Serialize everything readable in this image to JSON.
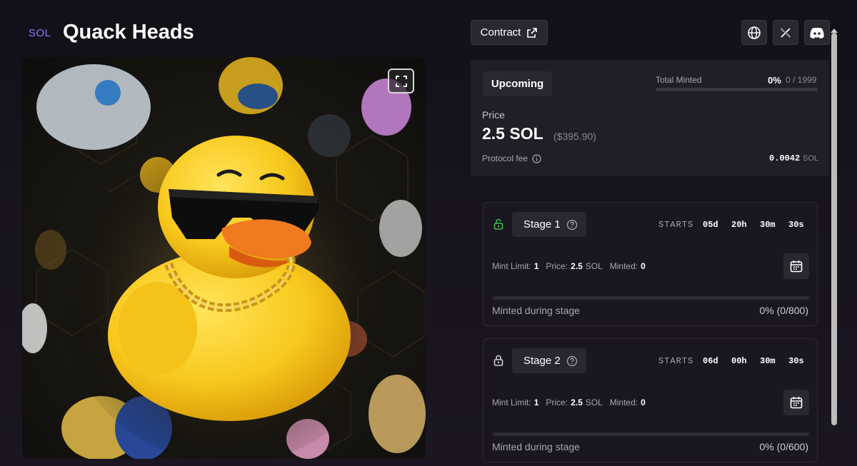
{
  "header": {
    "chain": "SOL",
    "title": "Quack Heads"
  },
  "toolbar": {
    "contract_label": "Contract",
    "social_icons": [
      "globe-icon",
      "x-icon",
      "discord-icon"
    ]
  },
  "artwork": {
    "expand_icon": "expand-icon"
  },
  "mint": {
    "status": "Upcoming",
    "total_minted_label": "Total Minted",
    "minted_percent": "0%",
    "minted_count": "0 / 1999",
    "minted_fraction": 0,
    "price_label": "Price",
    "price": "2.5 SOL",
    "price_usd": "($395.90)",
    "fee_label": "Protocol fee",
    "fee_value": "0.0042",
    "fee_unit": "SOL"
  },
  "stages": [
    {
      "name": "Stage 1",
      "lock_color": "#3fb950",
      "starts_label": "STARTS",
      "countdown": [
        "05d",
        "20h",
        "30m",
        "30s"
      ],
      "mint_limit_label": "Mint Limit:",
      "mint_limit": "1",
      "price_label": "Price:",
      "price_value": "2.5",
      "price_unit": "SOL",
      "minted_label": "Minted:",
      "minted": "0",
      "minted_during_label": "Minted during stage",
      "minted_during_value": "0% (0/800)"
    },
    {
      "name": "Stage 2",
      "lock_color": "#d0ccd8",
      "starts_label": "STARTS",
      "countdown": [
        "06d",
        "00h",
        "30m",
        "30s"
      ],
      "mint_limit_label": "Mint Limit:",
      "mint_limit": "1",
      "price_label": "Price:",
      "price_value": "2.5",
      "price_unit": "SOL",
      "minted_label": "Minted:",
      "minted": "0",
      "minted_during_label": "Minted during stage",
      "minted_during_value": "0% (0/600)"
    }
  ],
  "colors": {
    "accent": "#8b7cf6",
    "background": "#121019",
    "panel": "#211e28"
  }
}
